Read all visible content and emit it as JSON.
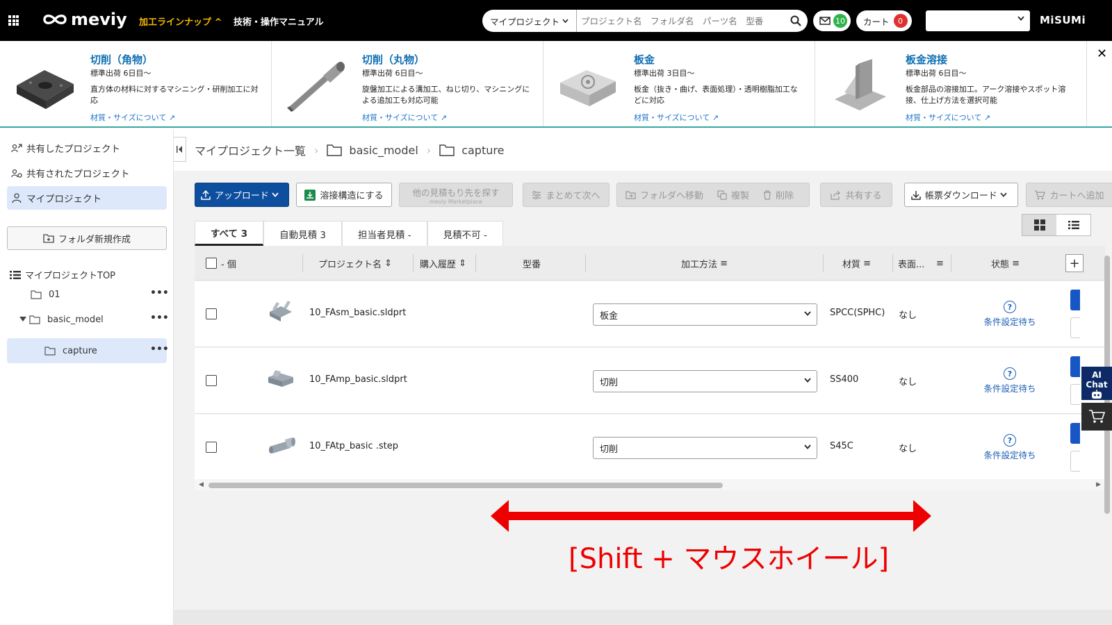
{
  "header": {
    "logo": "meviy",
    "nav_lineup": "加工ラインナップ ^",
    "nav_manual": "技術・操作マニュアル",
    "search_scope": "マイプロジェクト",
    "search_placeholder": "プロジェクト名　フォルダ名　パーツ名　型番",
    "mail_count": "10",
    "cart_label": "カート",
    "cart_count": "0",
    "brand": "MiSUMi"
  },
  "processes": [
    {
      "name": "切削（角物）",
      "lead": "標準出荷 6日目～",
      "desc": "直方体の材料に対するマシニング・研削加工に対応",
      "link": "材質・サイズについて"
    },
    {
      "name": "切削（丸物）",
      "lead": "標準出荷 6日目～",
      "desc": "旋盤加工による溝加工、ねじ切り、マシニングによる追加工も対応可能",
      "link": "材質・サイズについて"
    },
    {
      "name": "板金",
      "lead": "標準出荷 3日目～",
      "desc": "板金（抜き・曲げ、表面処理）・透明樹脂加工などに対応",
      "link": "材質・サイズについて"
    },
    {
      "name": "板金溶接",
      "lead": "標準出荷 6日目～",
      "desc": "板金部品の溶接加工。アーク溶接やスポット溶接、仕上げ方法を選択可能",
      "link": "材質・サイズについて"
    }
  ],
  "sidebar": {
    "items": [
      {
        "label": "共有したプロジェクト"
      },
      {
        "label": "共有されたプロジェクト"
      },
      {
        "label": "マイプロジェクト"
      }
    ],
    "new_folder": "フォルダ新規作成",
    "tree_top": "マイプロジェクトTOP",
    "tree": [
      {
        "label": "01"
      },
      {
        "label": "basic_model"
      },
      {
        "label": "capture"
      }
    ]
  },
  "breadcrumb": {
    "root": "マイプロジェクト一覧",
    "level1": "basic_model",
    "level2": "capture"
  },
  "toolbar": {
    "upload": "アップロード",
    "weld": "溶接構造にする",
    "market": "他の見積もり先を探す",
    "market_sub": "meviy Marketplace",
    "batch_next": "まとめて次へ",
    "move_folder": "フォルダへ移動",
    "duplicate": "複製",
    "delete": "削除",
    "share": "共有する",
    "download": "帳票ダウンロード",
    "add_cart": "カートへ追加"
  },
  "tabs": [
    {
      "label": "すべて 3"
    },
    {
      "label": "自動見積 3"
    },
    {
      "label": "担当者見積 -"
    },
    {
      "label": "見積不可 -"
    }
  ],
  "columns": {
    "count": "- 個",
    "project_name": "プロジェクト名",
    "purchase_history": "購入履歴",
    "model_number": "型番",
    "process": "加工方法",
    "material": "材質",
    "surface": "表面...",
    "status": "状態"
  },
  "rows": [
    {
      "name": "10_FAsm_basic.sldprt",
      "process": "板金",
      "material": "SPCC(SPHC)",
      "surface": "なし",
      "status": "条件設定待ち"
    },
    {
      "name": "10_FAmp_basic.sldprt",
      "process": "切削",
      "material": "SS400",
      "surface": "なし",
      "status": "条件設定待ち"
    },
    {
      "name": "10_FAtp_basic .step",
      "process": "切削",
      "material": "S45C",
      "surface": "なし",
      "status": "条件設定待ち"
    }
  ],
  "hint": "[Shift + マウスホイール]",
  "ai_chat": "AI Chat",
  "colors": {
    "accent": "#0d4f9e",
    "brand_teal": "#35a7a3",
    "nav_yellow": "#f5b800",
    "hint_red": "#e00000"
  }
}
